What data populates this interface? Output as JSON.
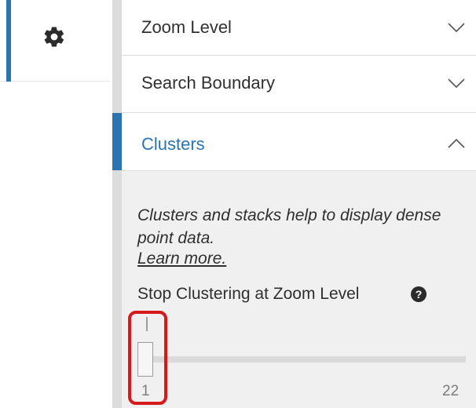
{
  "rail": {
    "settings_icon": "gear-icon"
  },
  "accordion": {
    "items": [
      {
        "label": "Zoom Level",
        "state": "collapsed",
        "chevron": "chevron-down-icon"
      },
      {
        "label": "Search Boundary",
        "state": "collapsed",
        "chevron": "chevron-down-icon"
      },
      {
        "label": "Clusters",
        "state": "expanded",
        "chevron": "chevron-up-icon"
      }
    ]
  },
  "clusters": {
    "description": "Clusters and stacks help to display dense point data.",
    "learn_more": "Learn more.",
    "stop_clustering_label": "Stop Clustering at Zoom Level",
    "help_icon": "question-circle-icon",
    "help_glyph": "?",
    "slider": {
      "min_label": "1",
      "max_label": "22",
      "value": 1
    }
  },
  "colors": {
    "accent": "#2a74b0",
    "highlight": "#d7191c",
    "body_bg": "#f0f0f0"
  }
}
